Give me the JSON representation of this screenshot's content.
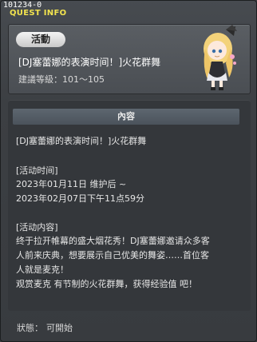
{
  "window": {
    "id": "101234-0",
    "title": "QUEST INFO"
  },
  "info": {
    "badge": "活動",
    "quest_name": "[DJ塞蕾娜的表演时间！]火花群舞",
    "level_label": "建議等級：",
    "level_value": "101～105"
  },
  "content": {
    "header": "內容",
    "lines": [
      "[DJ塞蕾娜的表演时间！]火花群舞",
      "[活动时间]",
      "2023年01月11日  维护后 ~",
      "2023年02月07日下午11点59分",
      "[活动内容]",
      "终于拉开帷幕的盛大烟花秀！DJ塞蕾娜邀请众多客",
      "人前来庆典，想要展示自己优美的舞姿……首位客",
      "人就是麦克！",
      "观赏麦克 有节制的火花群舞，获得经验值 吧！"
    ]
  },
  "status": {
    "label": "狀態：",
    "value": "可開始"
  },
  "colors": {
    "title": "#f3e44e",
    "panel": "#4a4e53",
    "header": "#56606a"
  },
  "icons": {
    "npc": "npc-portrait-icon"
  }
}
